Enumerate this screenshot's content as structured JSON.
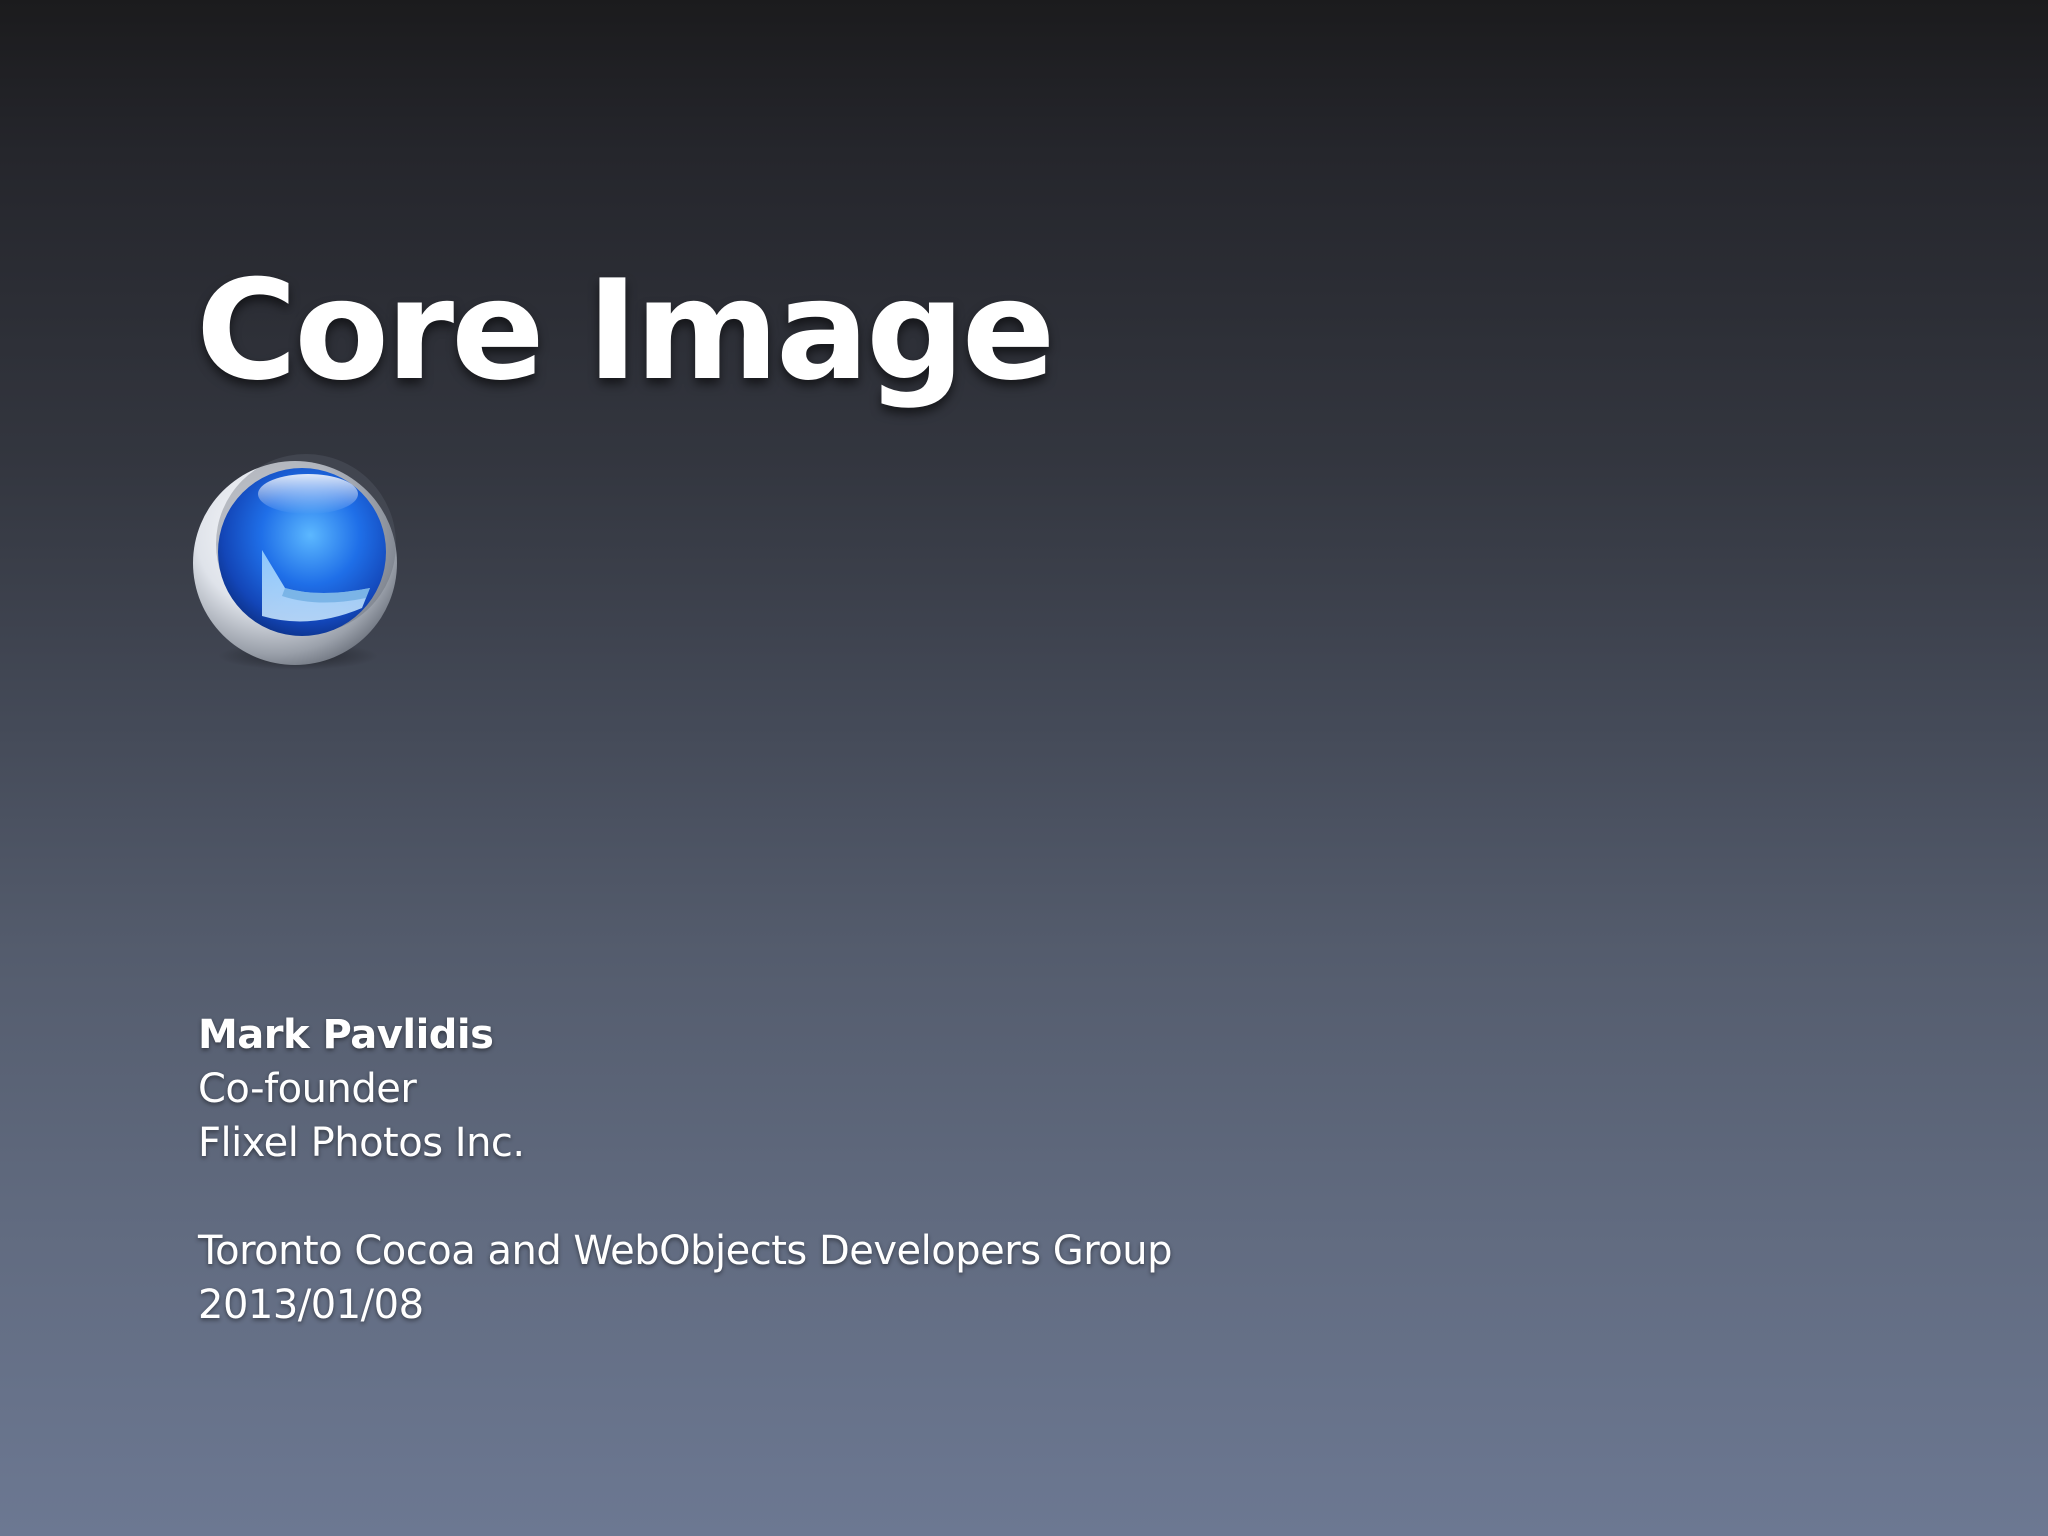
{
  "slide": {
    "title": "Core Image",
    "logo_icon": "core-image-sphere-icon",
    "presenter": {
      "name": "Mark Pavlidis",
      "role": "Co-founder",
      "company": "Flixel Photos Inc."
    },
    "event": {
      "name": "Toronto Cocoa and WebObjects Developers Group",
      "date": "2013/01/08"
    }
  }
}
